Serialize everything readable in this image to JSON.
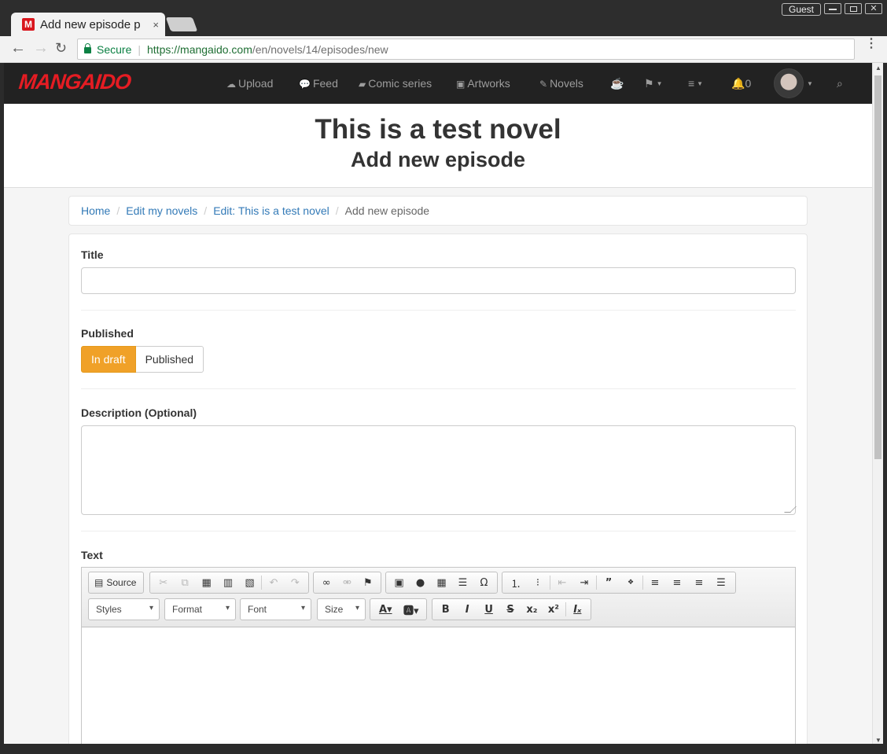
{
  "browser": {
    "tab_title": "Add new episode p",
    "tab_close": "×",
    "favicon": "M",
    "guest_label": "Guest",
    "secure_label": "Secure",
    "url_scheme": "https://",
    "url_host": "mangaido.com",
    "url_path": "/en/novels/14/episodes/new",
    "menu": "⋮"
  },
  "site": {
    "logo": "MANGAIDO",
    "nav": {
      "upload": "Upload",
      "feed": "Feed",
      "comic_series": "Comic series",
      "artworks": "Artworks",
      "novels": "Novels",
      "notifications": "0"
    }
  },
  "header": {
    "novel_title": "This is a test novel",
    "subtitle": "Add new episode"
  },
  "breadcrumb": {
    "items": [
      "Home",
      "Edit my novels",
      "Edit: This is a test novel"
    ],
    "separator": "/",
    "current": "Add new episode"
  },
  "form": {
    "title_label": "Title",
    "title_value": "",
    "published_label": "Published",
    "in_draft_label": "In draft",
    "published_option_label": "Published",
    "selected_state": "In draft",
    "description_label": "Description (Optional)",
    "description_value": "",
    "text_label": "Text"
  },
  "editor": {
    "source_label": "Source",
    "styles_label": "Styles",
    "format_label": "Format",
    "font_label": "Font",
    "size_label": "Size"
  },
  "colors": {
    "accent": "#f0a128",
    "link": "#337ab7",
    "logo": "#e51c23",
    "nav_bg": "#222222",
    "secure": "#0b8043"
  }
}
